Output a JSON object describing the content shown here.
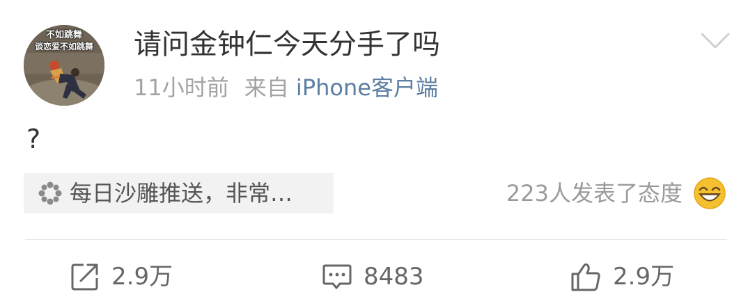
{
  "post": {
    "avatar_caption_line1": "不如跳舞",
    "avatar_caption_line2": "谈恋爱不如跳舞",
    "title": "请问金钟仁今天分手了吗",
    "time": "11小时前",
    "source_prefix": "来自",
    "source_app": "iPhone客户端",
    "body": "?",
    "tag_label": "每日沙雕推送，非常…",
    "reaction_text": "223人发表了态度"
  },
  "actions": {
    "repost_count": "2.9万",
    "comment_count": "8483",
    "like_count": "2.9万"
  },
  "icons": {
    "menu": "chevron-down-icon",
    "tag": "flower-icon",
    "reaction": "grinning-face-emoji",
    "repost": "share-icon",
    "comment": "comment-icon",
    "like": "thumbs-up-icon"
  },
  "colors": {
    "title": "#333333",
    "meta": "#a3a3a3",
    "source_link": "#5d7ea3",
    "chip_bg": "#f2f2f2",
    "emoji": "#f5c030"
  }
}
